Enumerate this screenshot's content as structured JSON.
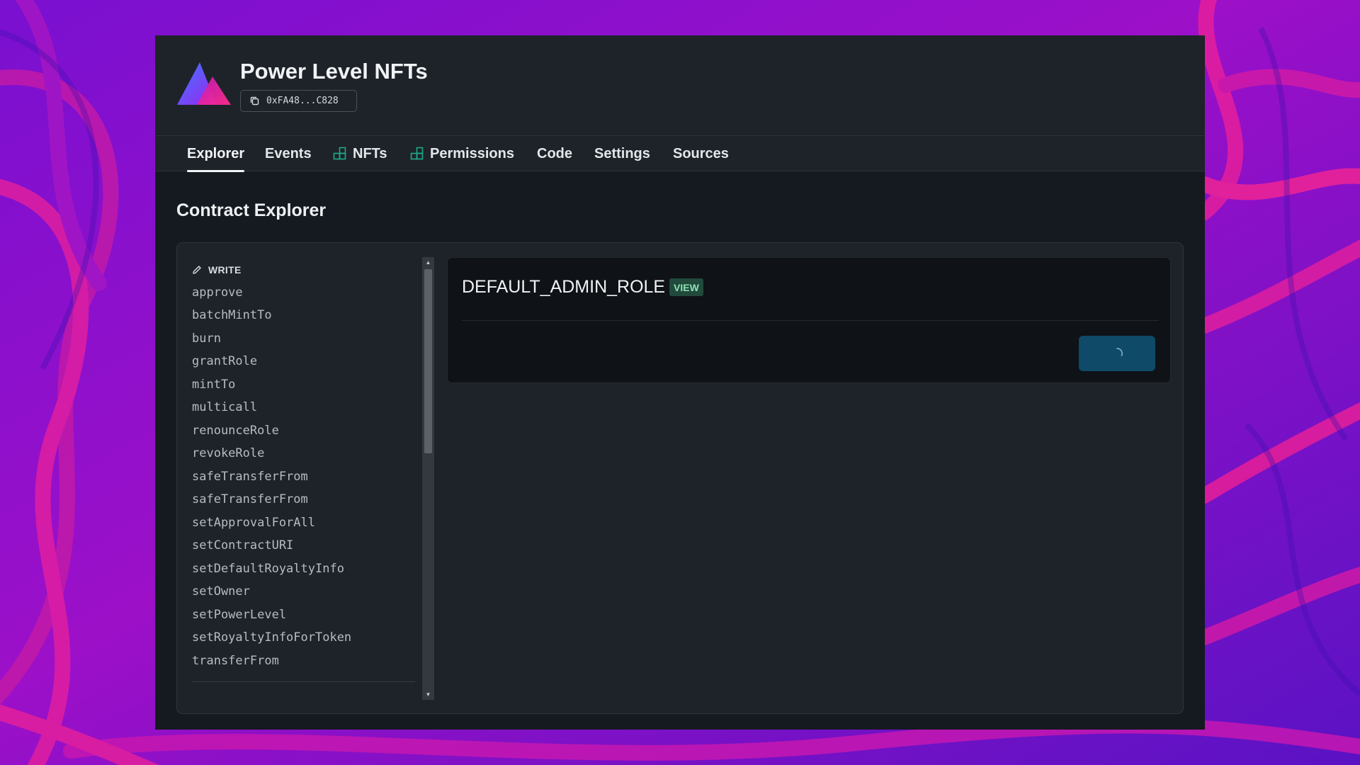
{
  "contract": {
    "name": "Power Level NFTs",
    "address_short": "0xFA48...C828"
  },
  "tabs": [
    {
      "label": "Explorer",
      "active": true,
      "icon": null
    },
    {
      "label": "Events",
      "active": false,
      "icon": null
    },
    {
      "label": "NFTs",
      "active": false,
      "icon": "extension-icon"
    },
    {
      "label": "Permissions",
      "active": false,
      "icon": "extension-icon"
    },
    {
      "label": "Code",
      "active": false,
      "icon": null
    },
    {
      "label": "Settings",
      "active": false,
      "icon": null
    },
    {
      "label": "Sources",
      "active": false,
      "icon": null
    }
  ],
  "page": {
    "title": "Contract Explorer"
  },
  "functions": {
    "section_label": "WRITE",
    "section_icon": "pencil-icon",
    "items": [
      "approve",
      "batchMintTo",
      "burn",
      "grantRole",
      "mintTo",
      "multicall",
      "renounceRole",
      "revokeRole",
      "safeTransferFrom",
      "safeTransferFrom",
      "setApprovalForAll",
      "setContractURI",
      "setDefaultRoyaltyInfo",
      "setOwner",
      "setPowerLevel",
      "setRoyaltyInfoForToken",
      "transferFrom"
    ]
  },
  "selected_function": {
    "name": "DEFAULT_ADMIN_ROLE",
    "badge": "VIEW",
    "button_state": "loading"
  },
  "colors": {
    "accent_teal": "#22a888",
    "run_button": "#0f4a68",
    "view_badge_bg": "#214a3c",
    "view_badge_text": "#8ee0b5"
  }
}
